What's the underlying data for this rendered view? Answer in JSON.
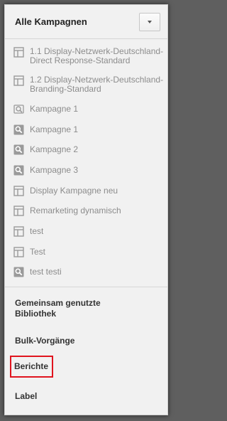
{
  "header": {
    "title": "Alle Kampagnen"
  },
  "campaigns": [
    {
      "icon": "table-icon",
      "line1": "1.1 Display-Netzwerk-Deutschland-",
      "line2": "Direct Response-Standard"
    },
    {
      "icon": "table-icon",
      "line1": "1.2 Display-Netzwerk-Deutschland-",
      "line2": "Branding-Standard"
    },
    {
      "icon": "search-gear-icon",
      "line1": "Kampagne 1"
    },
    {
      "icon": "search-icon",
      "line1": "Kampagne 1"
    },
    {
      "icon": "search-icon",
      "line1": "Kampagne 2"
    },
    {
      "icon": "search-icon",
      "line1": "Kampagne 3"
    },
    {
      "icon": "table-icon",
      "line1": "Display Kampagne neu"
    },
    {
      "icon": "table-icon",
      "line1": "Remarketing dynamisch"
    },
    {
      "icon": "table-icon",
      "line1": "test"
    },
    {
      "icon": "table-icon",
      "line1": "Test"
    },
    {
      "icon": "search-icon",
      "line1": "test testi"
    }
  ],
  "sections": {
    "shared_library_line1": "Gemeinsam genutzte",
    "shared_library_line2": "Bibliothek",
    "bulk": "Bulk-Vorgänge",
    "reports": "Berichte",
    "label": "Label"
  },
  "colors": {
    "highlight_border": "#e0141e",
    "icon": "#9a9a9a"
  }
}
